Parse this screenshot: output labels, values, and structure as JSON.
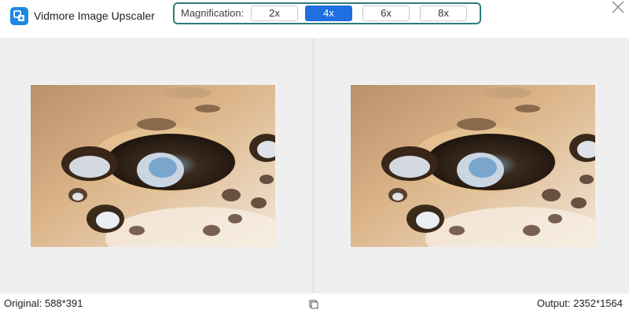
{
  "app": {
    "title": "Vidmore Image Upscaler",
    "icon": "app-logo-icon"
  },
  "magnification": {
    "label": "Magnification:",
    "options": [
      "2x",
      "4x",
      "6x",
      "8x"
    ],
    "selected": "4x"
  },
  "window": {
    "close_icon": "close-icon"
  },
  "footer": {
    "original": "Original: 588*391",
    "output": "Output: 2352*1564",
    "compare_icon": "compare-icon"
  },
  "colors": {
    "accent": "#1f6fe0",
    "frame": "#2e7d7a",
    "background": "#efefef"
  }
}
